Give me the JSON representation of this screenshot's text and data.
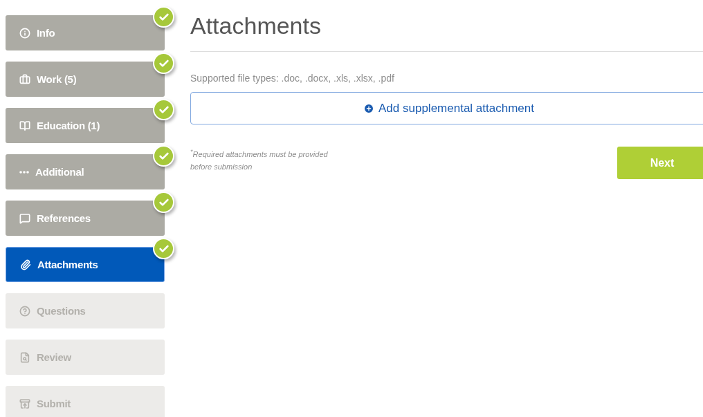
{
  "steps": [
    {
      "label": "Info",
      "done": true,
      "selected": false,
      "disabled": false
    },
    {
      "label": "Work (5)",
      "done": true,
      "selected": false,
      "disabled": false
    },
    {
      "label": "Education (1)",
      "done": true,
      "selected": false,
      "disabled": false
    },
    {
      "label": "Additional",
      "done": true,
      "selected": false,
      "disabled": false
    },
    {
      "label": "References",
      "done": true,
      "selected": false,
      "disabled": false
    },
    {
      "label": "Attachments",
      "done": true,
      "selected": true,
      "disabled": false
    },
    {
      "label": "Questions",
      "done": false,
      "selected": false,
      "disabled": true
    },
    {
      "label": "Review",
      "done": false,
      "selected": false,
      "disabled": true
    },
    {
      "label": "Submit",
      "done": false,
      "selected": false,
      "disabled": true
    }
  ],
  "title": "Attachments",
  "supported_types": "Supported file types: .doc, .docx, .xls, .xlsx, .pdf",
  "add_button": "Add supplemental attachment",
  "note": "$^{*}$Required attachments must be provided before submission",
  "next_button": "Next"
}
